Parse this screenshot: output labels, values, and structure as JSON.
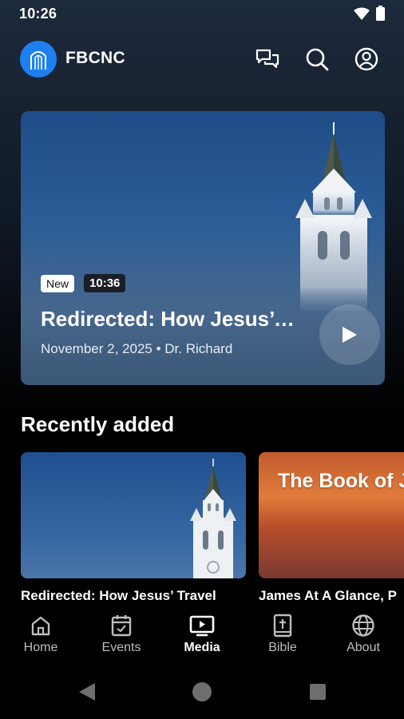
{
  "status_bar": {
    "time": "10:26"
  },
  "header": {
    "app_name": "FBCNC"
  },
  "hero": {
    "badge_new": "New",
    "duration": "10:36",
    "title": "Redirected: How Jesus’ Travel Plans Changed",
    "subtitle": "November 2, 2025 • Dr. Richard"
  },
  "recently_added": {
    "title": "Recently added",
    "items": [
      {
        "caption": "Redirected: How Jesus’ Travel"
      },
      {
        "thumb_text": "The Book of J",
        "caption": "James At A Glance, P"
      }
    ]
  },
  "nav": {
    "items": [
      {
        "label": "Home",
        "icon": "home-icon"
      },
      {
        "label": "Events",
        "icon": "calendar-icon"
      },
      {
        "label": "Media",
        "icon": "tv-icon",
        "active": true
      },
      {
        "label": "Bible",
        "icon": "bible-icon"
      },
      {
        "label": "About",
        "icon": "globe-icon"
      }
    ]
  },
  "colors": {
    "accent": "#1e7ff0",
    "background": "#000000"
  }
}
